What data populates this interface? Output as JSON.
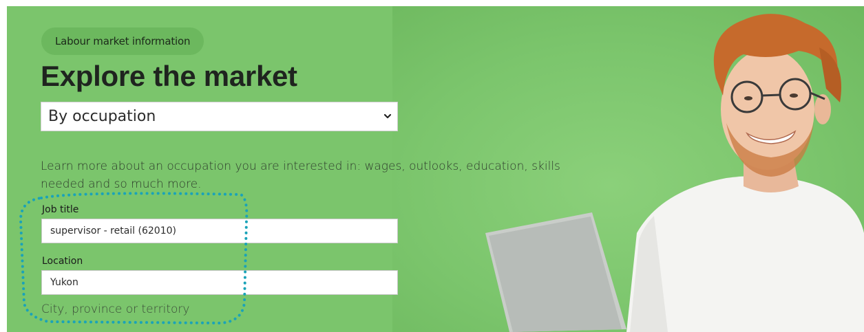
{
  "breadcrumb": {
    "label": "Labour market information"
  },
  "page": {
    "title": "Explore the market"
  },
  "explore_by": {
    "selected": "By occupation"
  },
  "description": "Learn more about an occupation you are interested in: wages, outlooks, education, skills needed and so much more.",
  "job_title": {
    "label": "Job title",
    "value": "supervisor - retail (62010)"
  },
  "location": {
    "label": "Location",
    "value": "Yukon",
    "hint": "City, province or territory"
  },
  "colors": {
    "hero_background": "#7bc56c",
    "pill_background": "#6cb85e",
    "callout_border": "#1aa3b8"
  },
  "icons": {
    "select_arrow": "chevron-down-icon"
  }
}
